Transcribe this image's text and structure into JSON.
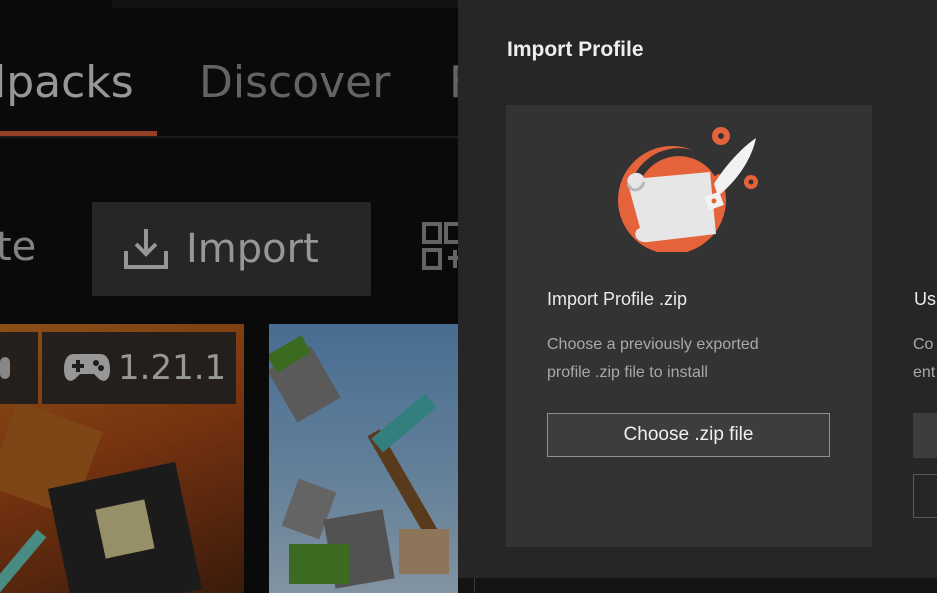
{
  "tabs": [
    {
      "label": "lpacks",
      "active": true
    },
    {
      "label": "Discover",
      "active": false
    },
    {
      "label": "F",
      "active": false
    }
  ],
  "toolbar": {
    "create_fragment": "te",
    "import_label": "Import",
    "import_icon": "download-tray-icon",
    "qr_icon": "qr-code-icon"
  },
  "modpack_card": {
    "game_version": "1.21.1",
    "loader_icon": "loader-icon",
    "version_icon": "gamepad-icon"
  },
  "modal": {
    "title": "Import Profile",
    "zip_option": {
      "heading": "Import Profile .zip",
      "description_line1": "Choose a previously exported",
      "description_line2": "profile .zip file to install",
      "button_label": "Choose .zip file",
      "illustration_icon": "scroll-quill-icon"
    },
    "code_option": {
      "heading_fragment": "Us",
      "description_line1_fragment": "Co",
      "description_line2_fragment": "ent"
    }
  },
  "colors": {
    "accent": "#e5633a",
    "modal_bg": "#262626",
    "panel_bg": "#333333"
  }
}
